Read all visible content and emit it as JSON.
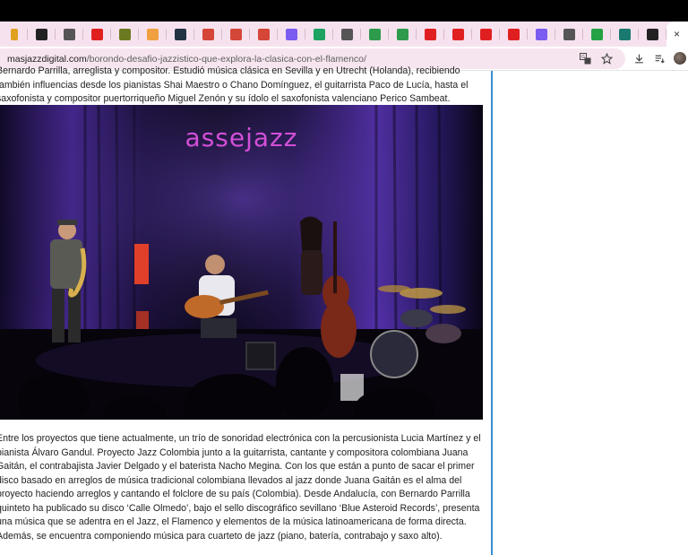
{
  "browser": {
    "url_host": "masjazzdigital.com",
    "url_path": "/borondo-desafio-jazzistico-que-explora-la-clasica-con-el-flamenco/",
    "tab_close_glyph": "×",
    "tabs": [
      {
        "icon": "partial-tab-icon",
        "color": "#e0a020"
      },
      {
        "icon": "app-tab-icon",
        "color": "#222222"
      },
      {
        "icon": "openai-tab-icon",
        "color": "#555555"
      },
      {
        "icon": "youtube-tab-icon",
        "color": "#e02020"
      },
      {
        "icon": "app-tab-icon",
        "color": "#6b7a20"
      },
      {
        "icon": "notes-tab-icon",
        "color": "#f0a040"
      },
      {
        "icon": "app-tab-icon",
        "color": "#223344"
      },
      {
        "icon": "gmail-tab-icon",
        "color": "#d44638"
      },
      {
        "icon": "gmail-tab-icon",
        "color": "#d44638"
      },
      {
        "icon": "gmail-tab-icon",
        "color": "#d44638"
      },
      {
        "icon": "app-tab-icon",
        "color": "#7b5cf0"
      },
      {
        "icon": "chat-tab-icon",
        "color": "#1ea362"
      },
      {
        "icon": "openai-tab-icon",
        "color": "#555555"
      },
      {
        "icon": "drive-tab-icon",
        "color": "#2d9b4b"
      },
      {
        "icon": "drive-tab-icon",
        "color": "#2d9b4b"
      },
      {
        "icon": "youtube-tab-icon",
        "color": "#e02020"
      },
      {
        "icon": "youtube-tab-icon",
        "color": "#e02020"
      },
      {
        "icon": "youtube-tab-icon",
        "color": "#e02020"
      },
      {
        "icon": "youtube-tab-icon",
        "color": "#e02020"
      },
      {
        "icon": "app-tab-icon",
        "color": "#7b5cf0"
      },
      {
        "icon": "globe-tab-icon",
        "color": "#555555"
      },
      {
        "icon": "whatsapp-tab-icon",
        "color": "#25a244"
      },
      {
        "icon": "sun-tab-icon",
        "color": "#1a7a70"
      },
      {
        "icon": "mj-tab-icon",
        "color": "#222222"
      }
    ]
  },
  "article": {
    "para_top_line1": "Bernardo Parrilla, arreglista y compositor. Estudió música clásica en Sevilla y en Utrecht (Holanda), recibiendo",
    "para_top_line2": "también influencias desde los pianistas Shai Maestro o Chano Domínguez, el guitarrista Paco de Lucía, hasta el",
    "para_top_line3": "saxofonista y compositor puertorriqueño Miguel Zenón y su ídolo el saxofonista valenciano Perico Sambeat.",
    "photo_title": "assejazz",
    "para_bottom": [
      "Entre los proyectos que tiene actualmente, un trío de sonoridad electrónica con la percusionista Lucia Martínez y el",
      "pianista Álvaro Gandul. Proyecto Jazz Colombia junto a la guitarrista, cantante y compositora colombiana Juana",
      "Gaitán, el contrabajista Javier Delgado y el baterista Nacho Megina. Con los que están a punto de sacar el primer",
      "disco basado en arreglos de música tradicional colombiana llevados al jazz donde Juana Gaitán es el alma del",
      "proyecto haciendo arreglos y cantando el folclore de su país (Colombia). Desde Andalucía, con Bernardo Parrilla",
      "quinteto ha publicado su disco ‘Calle Olmedo’, bajo el sello discográfico sevillano ‘Blue Asteroid Records’, presenta",
      "una música que se adentra en el Jazz, el Flamenco y elementos de la música latinoamericana de forma directa.",
      "Además, se encuentra componiendo música para cuarteto de jazz (piano, batería, contrabajo y saxo alto)."
    ]
  }
}
